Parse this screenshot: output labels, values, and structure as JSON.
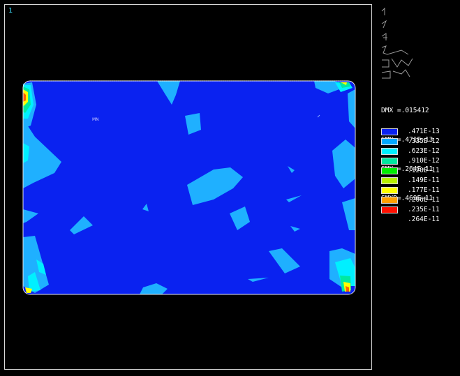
{
  "window_number": "1",
  "min_marker": "MN",
  "info": {
    "dmx": "DMX =.015412",
    "smn": "SMN =.471E-13",
    "smx": "SMX =.264E-11",
    "smxb": "SMXB=.469E-11"
  },
  "legend": [
    {
      "label": ".471E-13",
      "color": "#0a22f0"
    },
    {
      "label": ".335E-12",
      "color": "#00a8ff"
    },
    {
      "label": ".623E-12",
      "color": "#00f0ff"
    },
    {
      "label": ".910E-12",
      "color": "#00e8a0"
    },
    {
      "label": ".120E-11",
      "color": "#00ee00"
    },
    {
      "label": ".149E-11",
      "color": "#b8f000"
    },
    {
      "label": ".177E-11",
      "color": "#ffff00"
    },
    {
      "label": ".206E-11",
      "color": "#ffa000"
    },
    {
      "label": ".235E-11",
      "color": "#ff1000"
    },
    {
      "label": ".264E-11",
      "color": "#ffffff"
    }
  ],
  "colors": {
    "background": "#000000",
    "frame": "#d8d8d8",
    "window_number": "#3fe0ff",
    "plate_base": "#0a22f0",
    "contour_light": "#1fb0ff",
    "contour_cyan": "#00f0ff",
    "contour_green": "#00ee00",
    "contour_yellow": "#ffff00",
    "contour_red": "#ff1000"
  }
}
